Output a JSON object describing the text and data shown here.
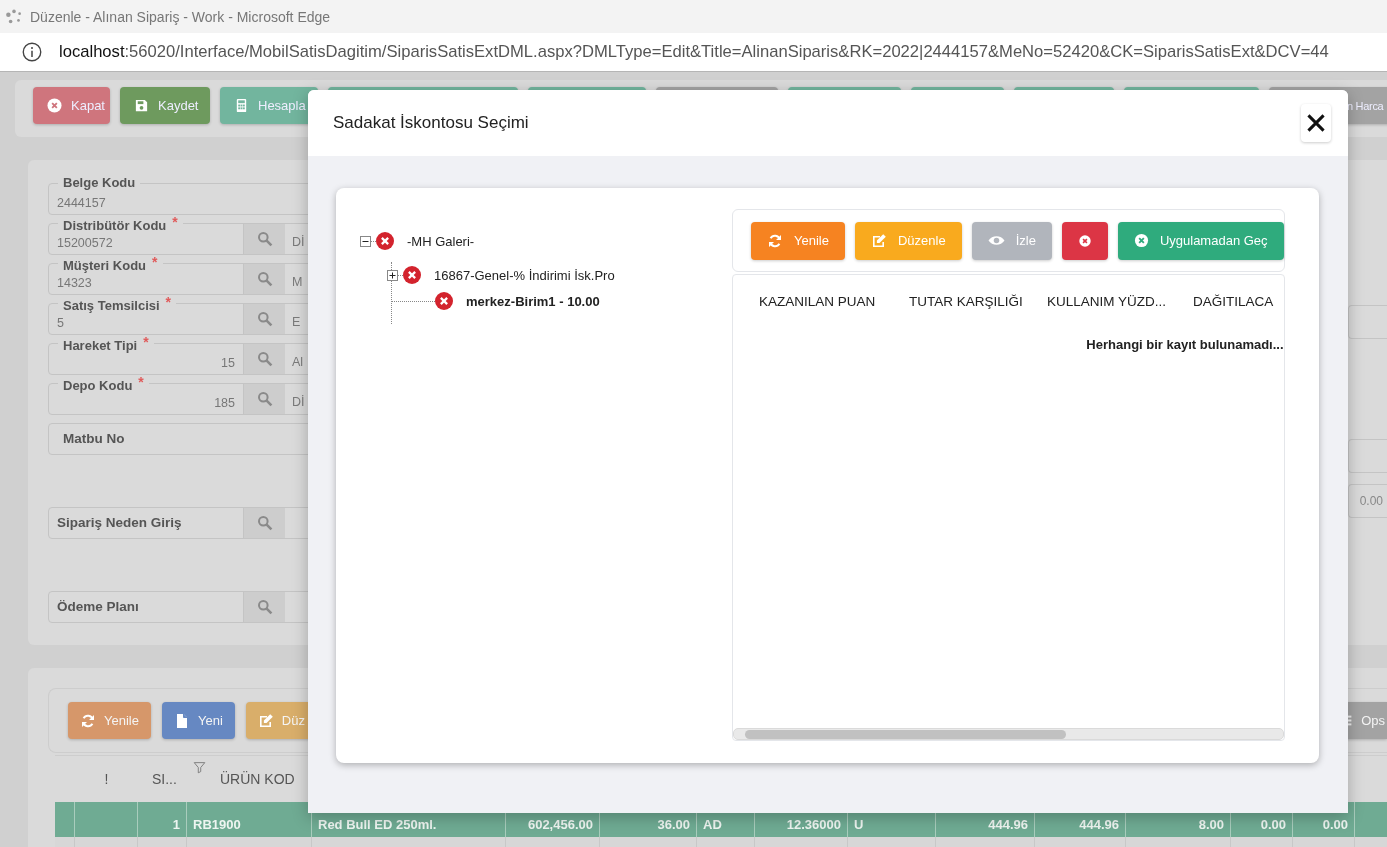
{
  "browser": {
    "title": "Düzenle - Alınan Sipariş - Work - Microsoft Edge",
    "url_host": "localhost",
    "url_rest": ":56020/Interface/MobilSatisDagitim/SiparisSatisExtDML.aspx?DMLType=Edit&Title=AlinanSiparis&RK=2022|2444157&MeNo=52420&CK=SiparisSatisExt&DCV=44"
  },
  "toolbar": {
    "buttons": [
      {
        "kind": "close",
        "label": "Kapat"
      },
      {
        "kind": "save",
        "label": "Kaydet"
      },
      {
        "kind": "calc",
        "label": "Hesapla"
      },
      {
        "kind": "teal"
      },
      {
        "kind": "teal"
      },
      {
        "kind": "gray"
      },
      {
        "kind": "teal"
      },
      {
        "kind": "teal"
      },
      {
        "kind": "teal"
      },
      {
        "kind": "teal"
      },
      {
        "kind": "gray",
        "label": "n Harca"
      }
    ]
  },
  "form": {
    "groups": [
      [
        {
          "kind": "text",
          "label": "Belge Kodu",
          "value": "2444157"
        },
        {
          "kind": "lookup",
          "label": "Distribütör Kodu",
          "required_mark": "*",
          "value": "15200572",
          "description": "Dİ"
        },
        {
          "kind": "lookup",
          "label": "Müşteri Kodu",
          "required_mark": "*",
          "value": "14323",
          "description": "M"
        },
        {
          "kind": "lookup",
          "label": "Satış Temsilcisi",
          "required_mark": "*",
          "value": "5",
          "description": "E"
        },
        {
          "kind": "lookup-number",
          "label": "Hareket Tipi",
          "required_mark": "*",
          "value": "15",
          "description": "Al"
        },
        {
          "kind": "lookup-number",
          "label": "Depo Kodu",
          "required_mark": "*",
          "value": "185",
          "description": "Dİ"
        },
        {
          "kind": "label-only",
          "label": "Matbu No"
        }
      ],
      [
        {
          "kind": "lookup-label",
          "label": "Sipariş Neden Giriş"
        }
      ],
      [
        {
          "kind": "lookup-label",
          "label": "Ödeme Planı"
        }
      ]
    ],
    "side_value": "0.00"
  },
  "lines": {
    "buttons": [
      {
        "kind": "refresh",
        "label": "Yenile"
      },
      {
        "kind": "new",
        "label": "Yeni"
      },
      {
        "kind": "edit",
        "label": "Düz"
      }
    ],
    "options_button": {
      "label": "Ops"
    },
    "columns": [
      {
        "label": "!"
      },
      {
        "label": "SI...",
        "filter": true
      },
      {
        "label": "ÜRÜN KOD"
      }
    ],
    "rows": [
      {
        "selected": true,
        "cells": [
          "1",
          "RB1900",
          "Red Bull ED 250ml.",
          "602,456.00",
          "36.00",
          "AD",
          "12.36000",
          "U",
          "444.96",
          "444.96",
          "8.00",
          "0.00",
          "0.00"
        ]
      }
    ]
  },
  "dialog": {
    "title": "Sadakat İskontosu Seçimi",
    "tree": [
      {
        "label": "-MH Galeri-",
        "expanded": true,
        "selected": false,
        "children": [
          {
            "label": "16867-Genel-% İndirimi İsk.Pro",
            "expanded": false,
            "selected": false
          },
          {
            "label": "merkez-Birim1 - 10.00",
            "selected": true
          }
        ]
      }
    ],
    "buttons": [
      {
        "kind": "refresh",
        "label": "Yenile"
      },
      {
        "kind": "edit",
        "label": "Düzenle"
      },
      {
        "kind": "view",
        "label": "İzle"
      },
      {
        "kind": "delete"
      },
      {
        "kind": "skip",
        "label": "Uygulamadan Geç"
      }
    ],
    "grid": {
      "columns": [
        "KAZANILAN PUAN",
        "TUTAR KARŞILIĞI",
        "KULLANIM YÜZD...",
        "DAĞITILACA"
      ],
      "empty_text": "Herhangi bir kayıt bulunamadı..."
    }
  }
}
